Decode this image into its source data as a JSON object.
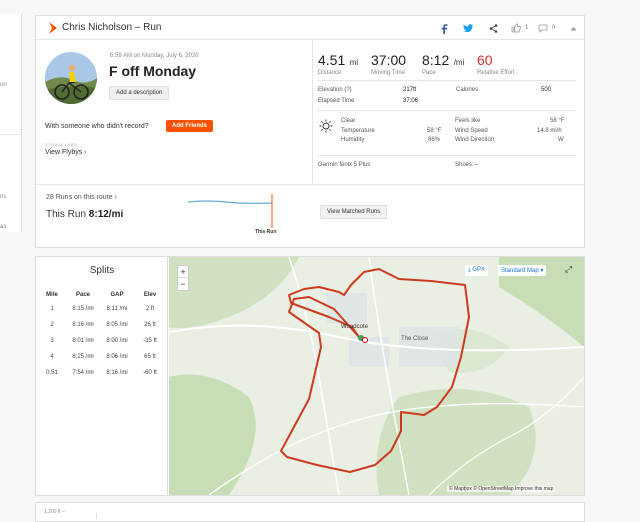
{
  "left_partial": {
    "items": [
      "on",
      "ns",
      "as"
    ]
  },
  "header": {
    "title": "Chris Nicholson – Run",
    "kudos_count": "1",
    "comments_count": "0"
  },
  "activity": {
    "datetime": "6:59 AM on Monday, July 6, 2020",
    "name": "F off Monday",
    "add_description": "Add a description",
    "someone_text": "With someone who didn't record?",
    "add_friends": "Add Friends",
    "flyby_label": "STRAVA LABS",
    "view_flybys": "View Flybys"
  },
  "stats": {
    "distance_value": "4.51",
    "distance_unit": "mi",
    "distance_label": "Distance",
    "moving_value": "37:00",
    "moving_label": "Moving Time",
    "pace_value": "8:12",
    "pace_unit": "/mi",
    "pace_label": "Pace",
    "effort_value": "60",
    "effort_label": "Relative Effort",
    "elevation_label": "Elevation (?)",
    "elevation_value": "217ft",
    "calories_label": "Calories",
    "calories_value": "500",
    "elapsed_label": "Elapsed Time",
    "elapsed_value": "37:06",
    "weather": {
      "condition": "Clear",
      "temperature_label": "Temperature",
      "temperature_value": "58 °F",
      "humidity_label": "Humidity",
      "humidity_value": "86%",
      "feels_label": "Feels like",
      "feels_value": "58 °F",
      "wind_speed_label": "Wind Speed",
      "wind_speed_value": "14.8 mi/h",
      "wind_dir_label": "Wind Direction",
      "wind_dir_value": "W"
    },
    "device": "Garmin fēnix 5 Plus",
    "shoes_label": "Shoes:",
    "shoes_value": "–"
  },
  "route": {
    "runs_text": "28 Runs on this route",
    "this_run_label": "This Run",
    "this_run_pace": "8:12/mi",
    "marker_label": "This Run",
    "view_matched": "View Matched Runs"
  },
  "splits": {
    "title": "Splits",
    "headers": [
      "Mile",
      "Pace",
      "GAP",
      "Elev"
    ],
    "rows": [
      [
        "1",
        "8:15 /mi",
        "8:11 /mi",
        "2 ft"
      ],
      [
        "2",
        "8:16 /mi",
        "8:05 /mi",
        "26 ft"
      ],
      [
        "3",
        "8:01 /mi",
        "8:00 /mi",
        "-35 ft"
      ],
      [
        "4",
        "8:25 /mi",
        "8:06 /mi",
        "65 ft"
      ],
      [
        "0.51",
        "7:54 /mi",
        "8:16 /mi",
        "-60 ft"
      ]
    ]
  },
  "map": {
    "gpx_label": "GPX",
    "style_label": "Standard Map",
    "place_woodcote": "Woodcote",
    "place_close": "The Close",
    "attribution": "© Mapbox © OpenStreetMap Improve this map",
    "zoom_in": "+",
    "zoom_out": "−",
    "bottom_axis_label": "1,200 ft –"
  },
  "colors": {
    "accent": "#fc5200",
    "route": "#d63b1f",
    "map_bg": "#e8eee2"
  }
}
